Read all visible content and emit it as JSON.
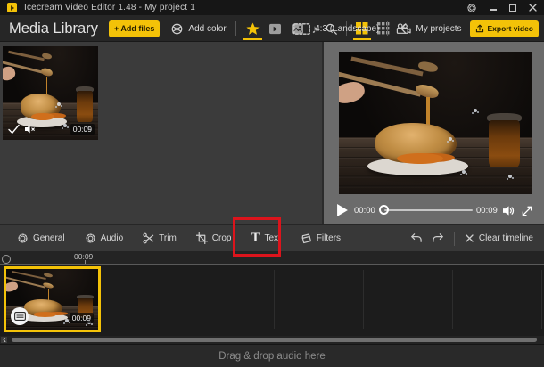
{
  "window": {
    "title": "Icecream Video Editor 1.48 - My project 1"
  },
  "header": {
    "panel_title": "Media Library",
    "add_files": "+ Add files",
    "add_color": "Add color",
    "aspect": "4:3 (Landscape)",
    "my_projects": "My projects",
    "export_video": "Export video"
  },
  "icons": {
    "music_note": "♪",
    "text_tool": "T"
  },
  "media_library": {
    "clip_duration": "00:09"
  },
  "preview": {
    "current_time": "00:00",
    "duration": "00:09"
  },
  "toolbar": {
    "items": [
      {
        "label": "General"
      },
      {
        "label": "Audio"
      },
      {
        "label": "Trim"
      },
      {
        "label": "Crop"
      },
      {
        "label": "Text"
      },
      {
        "label": "Filters"
      }
    ],
    "clear_timeline": "Clear timeline"
  },
  "timeline": {
    "ruler_mark": "00:09",
    "clip_duration": "00:09",
    "audio_hint": "Drag & drop audio here"
  },
  "colors": {
    "accent": "#f3c208",
    "annotation": "#dc141c"
  }
}
